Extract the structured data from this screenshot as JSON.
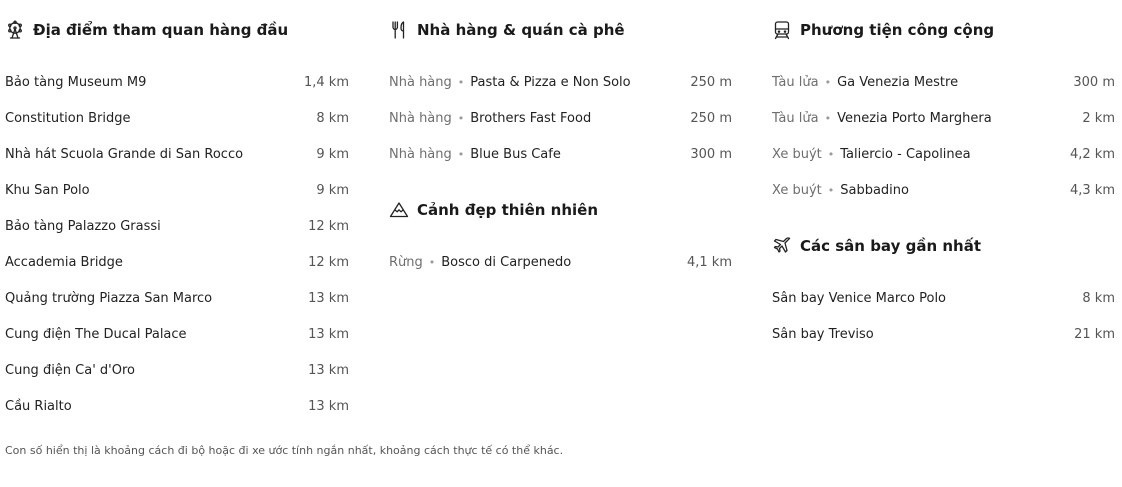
{
  "attractions": {
    "title": "Địa điểm tham quan hàng đầu",
    "icon": "ferris-wheel-icon",
    "items": [
      {
        "name": "Bảo tàng Museum M9",
        "distance": "1,4 km"
      },
      {
        "name": "Constitution Bridge",
        "distance": "8 km"
      },
      {
        "name": "Nhà hát Scuola Grande di San Rocco",
        "distance": "9 km"
      },
      {
        "name": "Khu San Polo",
        "distance": "9 km"
      },
      {
        "name": "Bảo tàng Palazzo Grassi",
        "distance": "12 km"
      },
      {
        "name": "Accademia Bridge",
        "distance": "12 km"
      },
      {
        "name": "Quảng trường Piazza San Marco",
        "distance": "13 km"
      },
      {
        "name": "Cung điện The Ducal Palace",
        "distance": "13 km"
      },
      {
        "name": "Cung điện Ca' d'Oro",
        "distance": "13 km"
      },
      {
        "name": "Cầu Rialto",
        "distance": "13 km"
      }
    ]
  },
  "restaurants": {
    "title": "Nhà hàng & quán cà phê",
    "icon": "fork-knife-icon",
    "items": [
      {
        "category": "Nhà hàng",
        "name": "Pasta & Pizza e Non Solo",
        "distance": "250 m"
      },
      {
        "category": "Nhà hàng",
        "name": "Brothers Fast Food",
        "distance": "250 m"
      },
      {
        "category": "Nhà hàng",
        "name": "Blue Bus Cafe",
        "distance": "300 m"
      }
    ]
  },
  "nature": {
    "title": "Cảnh đẹp thiên nhiên",
    "icon": "mountain-icon",
    "items": [
      {
        "category": "Rừng",
        "name": "Bosco di Carpenedo",
        "distance": "4,1 km"
      }
    ]
  },
  "transit": {
    "title": "Phương tiện công cộng",
    "icon": "train-icon",
    "items": [
      {
        "category": "Tàu lửa",
        "name": "Ga Venezia Mestre",
        "distance": "300 m"
      },
      {
        "category": "Tàu lửa",
        "name": "Venezia Porto Marghera",
        "distance": "2 km"
      },
      {
        "category": "Xe buýt",
        "name": "Taliercio - Capolinea",
        "distance": "4,2 km"
      },
      {
        "category": "Xe buýt",
        "name": "Sabbadino",
        "distance": "4,3 km"
      }
    ]
  },
  "airports": {
    "title": "Các sân bay gần nhất",
    "icon": "airplane-icon",
    "items": [
      {
        "name": "Sân bay Venice Marco Polo",
        "distance": "8 km"
      },
      {
        "name": "Sân bay Treviso",
        "distance": "21 km"
      }
    ]
  },
  "footnote": "Con số hiển thị là khoảng cách đi bộ hoặc đi xe ước tính ngắn nhất, khoảng cách thực tế có thể khác."
}
